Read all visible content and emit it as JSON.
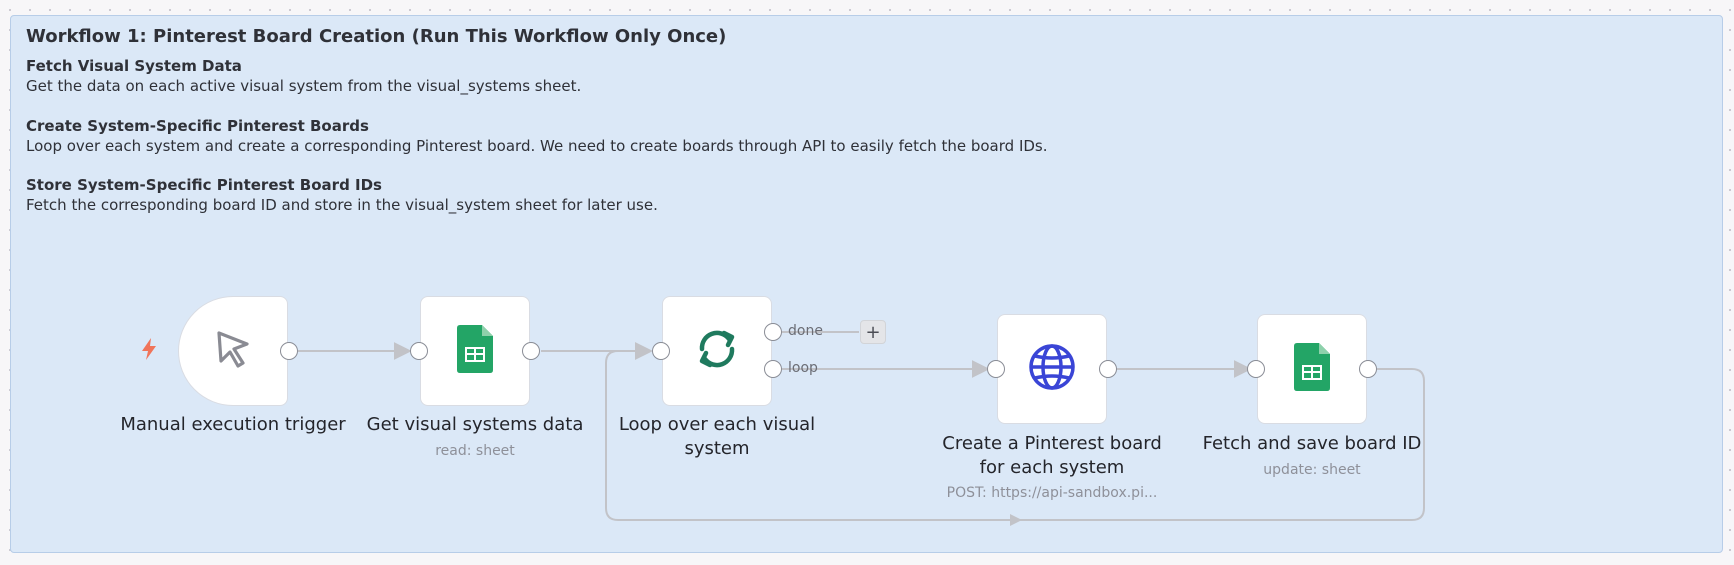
{
  "sticky": {
    "title": "Workflow 1: Pinterest Board Creation (Run This Workflow Only Once)",
    "sections": [
      {
        "heading": "Fetch Visual System Data",
        "body": "Get the data on each active visual system from the visual_systems sheet."
      },
      {
        "heading": "Create System-Specific Pinterest Boards",
        "body": "Loop over each system and create a corresponding Pinterest board. We need to create boards through API to easily fetch the board IDs."
      },
      {
        "heading": "Store System-Specific Pinterest Board IDs",
        "body": "Fetch the corresponding board ID and store in the visual_system sheet for later use."
      }
    ]
  },
  "nodes": {
    "trigger": {
      "label": "Manual execution trigger",
      "icon": "cursor-icon"
    },
    "get_data": {
      "label": "Get visual systems data",
      "subtitle": "read: sheet",
      "icon": "google-sheets-icon"
    },
    "loop": {
      "label_line1": "Loop over each visual",
      "label_line2": "system",
      "icon": "loop-icon"
    },
    "create_board": {
      "label_line1": "Create a Pinterest board",
      "label_line2": "for each system",
      "subtitle": "POST: https://api-sandbox.pi...",
      "icon": "globe-icon"
    },
    "fetch_save": {
      "label": "Fetch and save board ID",
      "subtitle": "update: sheet",
      "icon": "google-sheets-icon"
    }
  },
  "connections": {
    "done_label": "done",
    "loop_label": "loop",
    "add_symbol": "+"
  },
  "colors": {
    "sticky_bg": "#dbe8f7",
    "trigger_bolt": "#f0745a",
    "sheets_green": "#23a566",
    "loop_teal": "#1f7a5e",
    "globe_blue": "#3a45d6",
    "wire": "#c2c3c8"
  }
}
